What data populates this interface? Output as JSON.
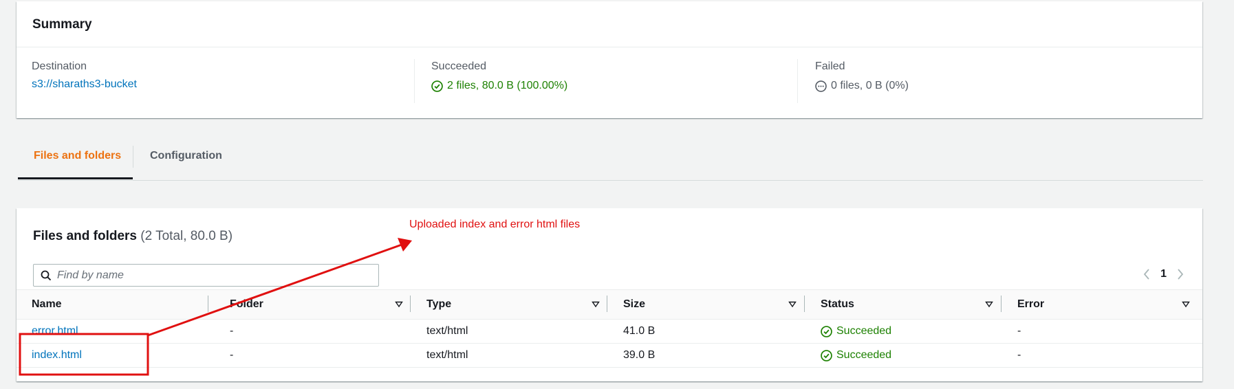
{
  "summary": {
    "title": "Summary",
    "destination": {
      "label": "Destination",
      "value": "s3://sharaths3-bucket"
    },
    "succeeded": {
      "label": "Succeeded",
      "value": "2 files, 80.0 B (100.00%)"
    },
    "failed": {
      "label": "Failed",
      "value": "0 files, 0 B (0%)"
    }
  },
  "tabs": [
    {
      "label": "Files and folders",
      "active": true
    },
    {
      "label": "Configuration",
      "active": false
    }
  ],
  "files": {
    "title": "Files and folders",
    "count": "(2 Total, 80.0 B)",
    "search_placeholder": "Find by name",
    "page": "1",
    "columns": [
      "Name",
      "Folder",
      "Type",
      "Size",
      "Status",
      "Error"
    ],
    "rows": [
      {
        "name": "error.html",
        "folder": "-",
        "type": "text/html",
        "size": "41.0 B",
        "status": "Succeeded",
        "error": "-"
      },
      {
        "name": "index.html",
        "folder": "-",
        "type": "text/html",
        "size": "39.0 B",
        "status": "Succeeded",
        "error": "-"
      }
    ]
  },
  "annotation": {
    "text": "Uploaded index and error html files"
  },
  "colors": {
    "accent": "#ec7211",
    "link": "#0073bb",
    "success": "#1d8102",
    "annotation": "#e01010"
  },
  "icons": [
    "success-check-icon",
    "pending-ellipsis-icon",
    "search-icon",
    "sort-caret-icon",
    "chevron-left-icon",
    "chevron-right-icon"
  ]
}
